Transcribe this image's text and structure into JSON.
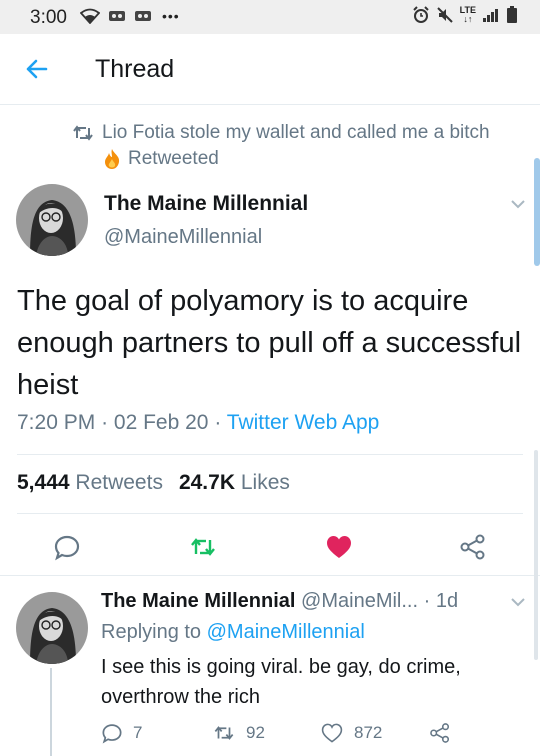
{
  "status_bar": {
    "time": "3:00",
    "network": "LTE"
  },
  "header": {
    "title": "Thread",
    "back_icon": "arrow-left-icon"
  },
  "retweet_context": {
    "retweeter": "Lio Fotia stole my wallet and called me a bitch",
    "label": "Retweeted"
  },
  "tweet": {
    "author_name": "The Maine Millennial",
    "author_handle": "@MaineMillennial",
    "text": "The goal of polyamory is to acquire enough partners to pull off a successful heist",
    "time": "7:20 PM",
    "date": "02 Feb 20",
    "source": "Twitter Web App",
    "retweets_count": "5,444",
    "retweets_label": "Retweets",
    "likes_count": "24.7K",
    "likes_label": "Likes",
    "colors": {
      "accent": "#1da1f2",
      "retweet": "#17bf63",
      "like": "#e0245e",
      "muted": "#657786"
    }
  },
  "reply": {
    "author_name": "The Maine Millennial",
    "author_handle": "@MaineMil...",
    "age": "1d",
    "replying_prefix": "Replying to",
    "replying_to": "@MaineMillennial",
    "text": "I see this is going viral. be gay, do crime, overthrow the rich",
    "replies": "7",
    "retweets": "92",
    "likes": "872"
  }
}
